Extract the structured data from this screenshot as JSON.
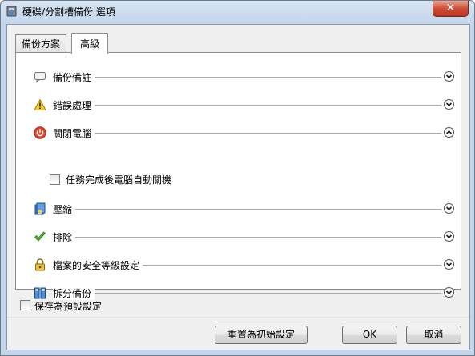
{
  "window": {
    "title": "硬碟/分割槽備份 選項",
    "close_label": "✕"
  },
  "tabs": [
    {
      "label": "備份方案",
      "active": false
    },
    {
      "label": "高級",
      "active": true
    }
  ],
  "sections": [
    {
      "label": "備份備註",
      "icon": "comment-icon",
      "expanded": false
    },
    {
      "label": "錯誤處理",
      "icon": "warning-icon",
      "expanded": false
    },
    {
      "label": "關閉電腦",
      "icon": "power-icon",
      "expanded": true
    },
    {
      "label": "壓縮",
      "icon": "compress-icon",
      "expanded": false
    },
    {
      "label": "排除",
      "icon": "checkmark-icon",
      "expanded": false
    },
    {
      "label": "檔案的安全等級設定",
      "icon": "lock-icon",
      "expanded": false
    },
    {
      "label": "拆分備份",
      "icon": "split-icon",
      "expanded": false
    }
  ],
  "shutdown_option": {
    "label": "任務完成後電腦自動關機",
    "checked": false
  },
  "save_default": {
    "label": "保存為預設設定",
    "checked": false
  },
  "buttons": {
    "reset": "重置為初始設定",
    "ok": "OK",
    "cancel": "取消"
  },
  "colors": {
    "title_bar": "#c2d5ea",
    "close_button": "#c1311a",
    "panel_bg": "#ffffff",
    "dialog_bg": "#f0f0f0"
  }
}
